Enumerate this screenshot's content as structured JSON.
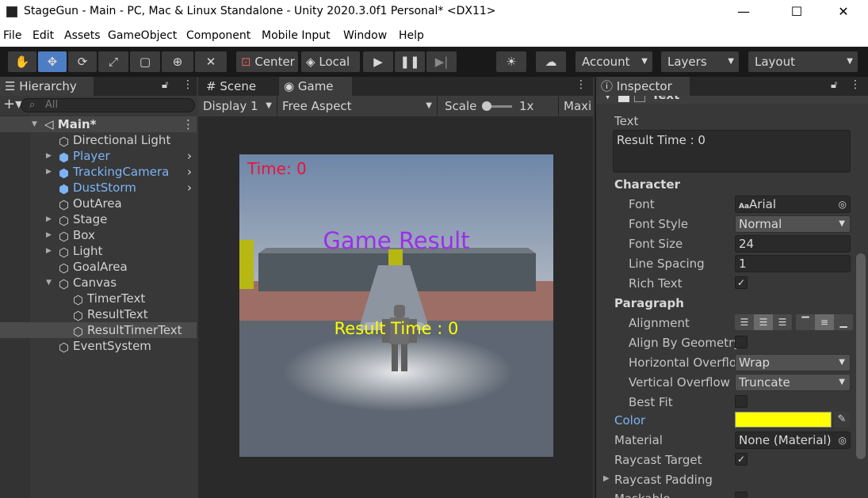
{
  "window": {
    "title": "StageGun - Main - PC, Mac & Linux Standalone - Unity 2020.3.0f1 Personal* <DX11>",
    "minimize": "—",
    "maximize": "☐",
    "close": "✕"
  },
  "menu": [
    "File",
    "Edit",
    "Assets",
    "GameObject",
    "Component",
    "Mobile Input",
    "Window",
    "Help"
  ],
  "toolbar": {
    "pivot_label": "Center",
    "space_label": "Local",
    "account_label": "Account",
    "layers_label": "Layers",
    "layout_label": "Layout"
  },
  "hierarchy": {
    "tab_label": "Hierarchy",
    "search_placeholder": "All",
    "items": [
      {
        "label": "Main*"
      },
      {
        "label": "Directional Light"
      },
      {
        "label": "Player"
      },
      {
        "label": "TrackingCamera"
      },
      {
        "label": "DustStorm"
      },
      {
        "label": "OutArea"
      },
      {
        "label": "Stage"
      },
      {
        "label": "Box"
      },
      {
        "label": "Light"
      },
      {
        "label": "GoalArea"
      },
      {
        "label": "Canvas"
      },
      {
        "label": "TimerText"
      },
      {
        "label": "ResultText"
      },
      {
        "label": "ResultTimerText"
      },
      {
        "label": "EventSystem"
      }
    ]
  },
  "game": {
    "scene_tab": "Scene",
    "game_tab": "Game",
    "display": "Display 1",
    "aspect": "Free Aspect",
    "scale_label": "Scale",
    "scale_value": "1x",
    "maximize_label": "Maxi",
    "time_text": "Time: 0",
    "result_text": "Game Result",
    "result_time_text": "Result Time : 0"
  },
  "inspector": {
    "tab_label": "Inspector",
    "component_name": "Text",
    "text_label": "Text",
    "text_value": "Result Time : 0",
    "character_label": "Character",
    "font_label": "Font",
    "font_value": "Arial",
    "font_style_label": "Font Style",
    "font_style_value": "Normal",
    "font_size_label": "Font Size",
    "font_size_value": "24",
    "line_spacing_label": "Line Spacing",
    "line_spacing_value": "1",
    "rich_text_label": "Rich Text",
    "paragraph_label": "Paragraph",
    "alignment_label": "Alignment",
    "align_by_geometry_label": "Align By Geometry",
    "horizontal_overflow_label": "Horizontal Overflo",
    "horizontal_overflow_value": "Wrap",
    "vertical_overflow_label": "Vertical Overflow",
    "vertical_overflow_value": "Truncate",
    "best_fit_label": "Best Fit",
    "color_label": "Color",
    "color_value": "#ffff00",
    "material_label": "Material",
    "material_value": "None (Material)",
    "raycast_target_label": "Raycast Target",
    "raycast_padding_label": "Raycast Padding",
    "maskable_label": "Maskable"
  },
  "colors": {
    "accent": "#4d7ec4",
    "prefab_blue": "#7cb4f5",
    "time_red": "#e8143c",
    "result_purple": "#9b2fe8",
    "result_yellow": "#ffff00"
  }
}
